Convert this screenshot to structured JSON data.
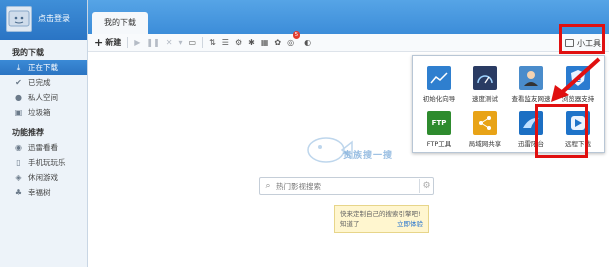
{
  "sidebar": {
    "login_text": "点击登录",
    "section_downloads": "我的下载",
    "items": [
      {
        "label": "正在下载",
        "icon": "download-icon",
        "active": true
      },
      {
        "label": "已完成",
        "icon": "check-icon",
        "active": false
      },
      {
        "label": "私人空间",
        "icon": "person-icon",
        "active": false
      },
      {
        "label": "垃圾箱",
        "icon": "trash-icon",
        "active": false
      }
    ],
    "section_features": "功能推荐",
    "features": [
      {
        "label": "迅雷看看",
        "icon": "video-icon"
      },
      {
        "label": "手机玩玩乐",
        "icon": "phone-icon"
      },
      {
        "label": "休闲游戏",
        "icon": "gamepad-icon"
      },
      {
        "label": "幸福树",
        "icon": "tree-icon"
      }
    ]
  },
  "main": {
    "tab_label": "我的下载",
    "toolbar": {
      "new_label": "新建",
      "badge_count": "5",
      "tools_label": "小工具"
    }
  },
  "popup": {
    "tools": [
      {
        "label": "初始化向导",
        "icon": "wizard-chart-icon",
        "color": "#2f7fcf"
      },
      {
        "label": "速度测试",
        "icon": "speedometer-icon",
        "color": "#2a3b63"
      },
      {
        "label": "查看监友网速",
        "icon": "support-person-icon",
        "color": "#4a8ccb"
      },
      {
        "label": "浏览器支持",
        "icon": "shield-e-icon",
        "color": "#2a7bd0"
      },
      {
        "label": "FTP工具",
        "icon": "ftp-icon",
        "color": "#2e8b2e",
        "badge": "FTP"
      },
      {
        "label": "局域网共享",
        "icon": "share-icon",
        "color": "#e8a317"
      },
      {
        "label": "迅雷阳台",
        "icon": "balcony-icon",
        "color": "#1c6fc3"
      },
      {
        "label": "远程下载",
        "icon": "remote-download-icon",
        "color": "#1e73c9"
      }
    ]
  },
  "search": {
    "placeholder": "热门影视搜索"
  },
  "tip": {
    "text": "快来定制自己的搜索引擎吧!",
    "dismiss": "知道了",
    "action": "立即体验"
  },
  "watermark": {
    "text": "贵族搜一搜"
  },
  "colors": {
    "accent": "#3c8dd9",
    "highlight": "#e01010"
  }
}
